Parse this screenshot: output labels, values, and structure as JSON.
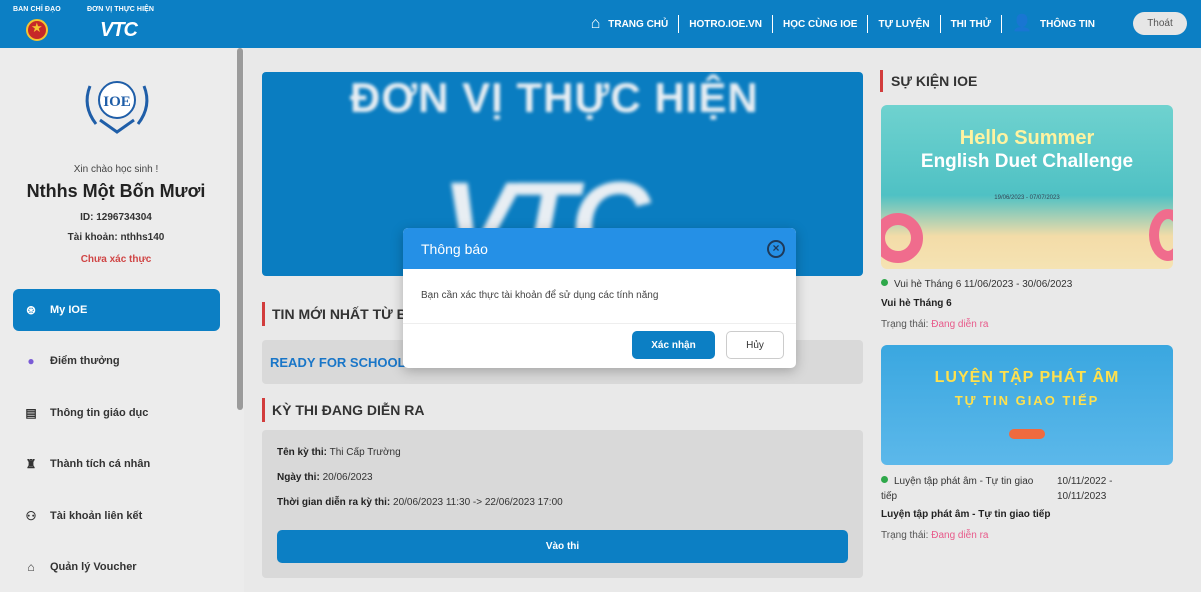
{
  "header": {
    "brand_left_caption": "BAN CHỈ ĐẠO",
    "brand_right_caption": "ĐƠN VỊ THỰC HIỆN",
    "brand_logo_text": "VTC",
    "nav": [
      "TRANG CHỦ",
      "HOTRO.IOE.VN",
      "HỌC CÙNG IOE",
      "TỰ LUYỆN",
      "THI THỬ",
      "THÔNG TIN"
    ],
    "logout_label": "Thoát"
  },
  "sidebar": {
    "logo_text": "IOE",
    "greeting": "Xin chào học sinh !",
    "name": "Nthhs Một Bốn Mươi",
    "id_line": "ID: 1296734304",
    "account_line": "Tài khoản: nthhs140",
    "status": "Chưa xác thực",
    "items": [
      {
        "label": "My IOE",
        "icon": "ioe-icon"
      },
      {
        "label": "Điểm thưởng",
        "icon": "coin-icon"
      },
      {
        "label": "Thông tin giáo dục",
        "icon": "book-icon"
      },
      {
        "label": "Thành tích cá nhân",
        "icon": "trophy-icon"
      },
      {
        "label": "Tài khoản liên kết",
        "icon": "link-icon"
      },
      {
        "label": "Quản lý Voucher",
        "icon": "voucher-icon"
      }
    ]
  },
  "main": {
    "banner_line1": "ĐƠN VỊ THỰC HIỆN",
    "banner_line2": "VTC",
    "news_title": "TIN MỚI NHẤT TỪ BA",
    "news_link": "READY FOR SCHOOL",
    "exam_title": "KỲ THI ĐANG DIỄN RA",
    "exam": {
      "name_label": "Tên kỳ thi:",
      "name_value": "Thi Cấp Trường",
      "date_label": "Ngày thi:",
      "date_value": "20/06/2023",
      "time_label": "Thời gian diễn ra kỳ thi:",
      "time_value": "20/06/2023 11:30 -> 22/06/2023 17:00",
      "enter_label": "Vào thi"
    }
  },
  "events": {
    "title": "SỰ KIỆN IOE",
    "items": [
      {
        "img_line1": "Hello Summer",
        "img_line2": "English Duet Challenge",
        "img_date": "19/06/2023 - 07/07/2023",
        "meta": "Vui hè Tháng 6 11/06/2023 - 30/06/2023",
        "name": "Vui hè Tháng 6",
        "status_label": "Trạng thái:",
        "status_value": "Đang diễn ra"
      },
      {
        "img_line1": "LUYỆN TẬP PHÁT ÂM",
        "img_line2": "TỰ TIN GIAO TIẾP",
        "meta_left": "Luyện tập phát âm - Tự tin giao tiếp",
        "meta_right": "10/11/2022 - 10/11/2023",
        "name": "Luyện tập phát âm - Tự tin giao tiếp",
        "status_label": "Trạng thái:",
        "status_value": "Đang diễn ra"
      }
    ]
  },
  "modal": {
    "title": "Thông báo",
    "message": "Bạn cần xác thực tài khoản để sử dụng các tính năng",
    "confirm_label": "Xác nhận",
    "cancel_label": "Hủy"
  },
  "colors": {
    "primary": "#0c7fc4",
    "modal_header": "#2590e6",
    "accent_red": "#d23c3c",
    "status_pink": "#e85a8a"
  }
}
